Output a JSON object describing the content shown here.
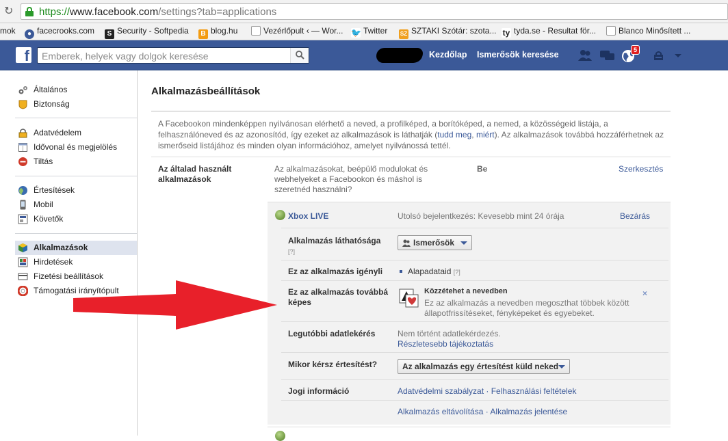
{
  "browser": {
    "url_scheme": "https://",
    "url_host": "www.facebook.com",
    "url_path": "/settings?tab=applications",
    "bookmarks": [
      {
        "label": "mok",
        "icon": "none"
      },
      {
        "label": "facecrooks.com",
        "icon": "facecrooks-icon"
      },
      {
        "label": "Security - Softpedia",
        "icon": "softpedia-icon"
      },
      {
        "label": "blog.hu",
        "icon": "blog-icon"
      },
      {
        "label": "Vezérlőpult ‹ — Wor...",
        "icon": "page-icon"
      },
      {
        "label": "Twitter",
        "icon": "twitter-icon"
      },
      {
        "label": "SZTAKI Szótár: szota...",
        "icon": "sztaki-icon"
      },
      {
        "label": "tyda.se - Resultat för...",
        "icon": "tyda-icon"
      },
      {
        "label": "Blanco Minősített ...",
        "icon": "page-icon"
      }
    ]
  },
  "fbbar": {
    "logo": "f",
    "search_placeholder": "Emberek, helyek vagy dolgok keresése",
    "home": "Kezdőlap",
    "find_friends": "Ismerősök keresése",
    "notif_count": "5"
  },
  "sidebar": {
    "items": [
      {
        "label": "Általános",
        "icon": "gears-icon"
      },
      {
        "label": "Biztonság",
        "icon": "badge-icon"
      },
      {
        "label": "Adatvédelem",
        "icon": "lock-icon"
      },
      {
        "label": "Idővonal és megjelölés",
        "icon": "timeline-icon"
      },
      {
        "label": "Tiltás",
        "icon": "block-icon"
      },
      {
        "label": "Értesítések",
        "icon": "globe-icon"
      },
      {
        "label": "Mobil",
        "icon": "mobile-icon"
      },
      {
        "label": "Követők",
        "icon": "rss-icon"
      },
      {
        "label": "Alkalmazások",
        "icon": "apps-icon"
      },
      {
        "label": "Hirdetések",
        "icon": "ads-icon"
      },
      {
        "label": "Fizetési beállítások",
        "icon": "payment-icon"
      },
      {
        "label": "Támogatási irányítópult",
        "icon": "lifebuoy-icon"
      }
    ]
  },
  "main": {
    "title": "Alkalmazásbeállítások",
    "intro_text_1": "A Facebookon mindenképpen nyilvánosan elérhető a neved, a profilképed, a borítóképed, a nemed, a közösségeid listája, a felhasználóneved és az azonosítód, így ezeket az alkalmazások is láthatják (",
    "intro_link_1": "tudd meg",
    "intro_sep": ", ",
    "intro_link_2": "miért",
    "intro_text_2": "). Az alkalmazások továbbá hozzáférhetnek az ismerőseid listájához és minden olyan információhoz, amelyet nyilvánossá tettél.",
    "row_label": "Az általad használt alkalmazások",
    "row_desc": "Az alkalmazásokat, beépülő modulokat és webhelyeket a Facebookon és máshol is szeretnéd használni?",
    "row_status": "Be",
    "row_edit": "Szerkesztés"
  },
  "app": {
    "name": "Xbox LIVE",
    "last_login": "Utolsó bejelentkezés: Kevesebb mint 24 órája",
    "close": "Bezárás",
    "visibility_label": "Alkalmazás láthatósága",
    "help": "[?]",
    "visibility_value": "Ismerősök",
    "requires_label": "Ez az alkalmazás igényli",
    "requires_value": "Alapadataid",
    "also_label": "Ez az alkalmazás továbbá képes",
    "perm_title": "Közzétehet a nevedben",
    "perm_desc": "Ez az alkalmazás a nevedben megoszthat többek között állapotfrissítéseket, fényképeket és egyebeket.",
    "perm_remove": "×",
    "last_request_label": "Legutóbbi adatlekérés",
    "last_request_value": "Nem történt adatlekérdezés.",
    "last_request_more": "Részletesebb tájékoztatás",
    "notify_label": "Mikor kérsz értesítést?",
    "notify_value": "Az alkalmazás egy értesítést küld neked",
    "legal_label": "Jogi információ",
    "legal_links": "Adatvédelmi szabályzat · Felhasználási feltételek",
    "remove_links": "Alkalmazás eltávolítása · Alkalmazás jelentése"
  },
  "colors": {
    "fb_blue": "#3b5998",
    "arrow_red": "#e8202a"
  }
}
